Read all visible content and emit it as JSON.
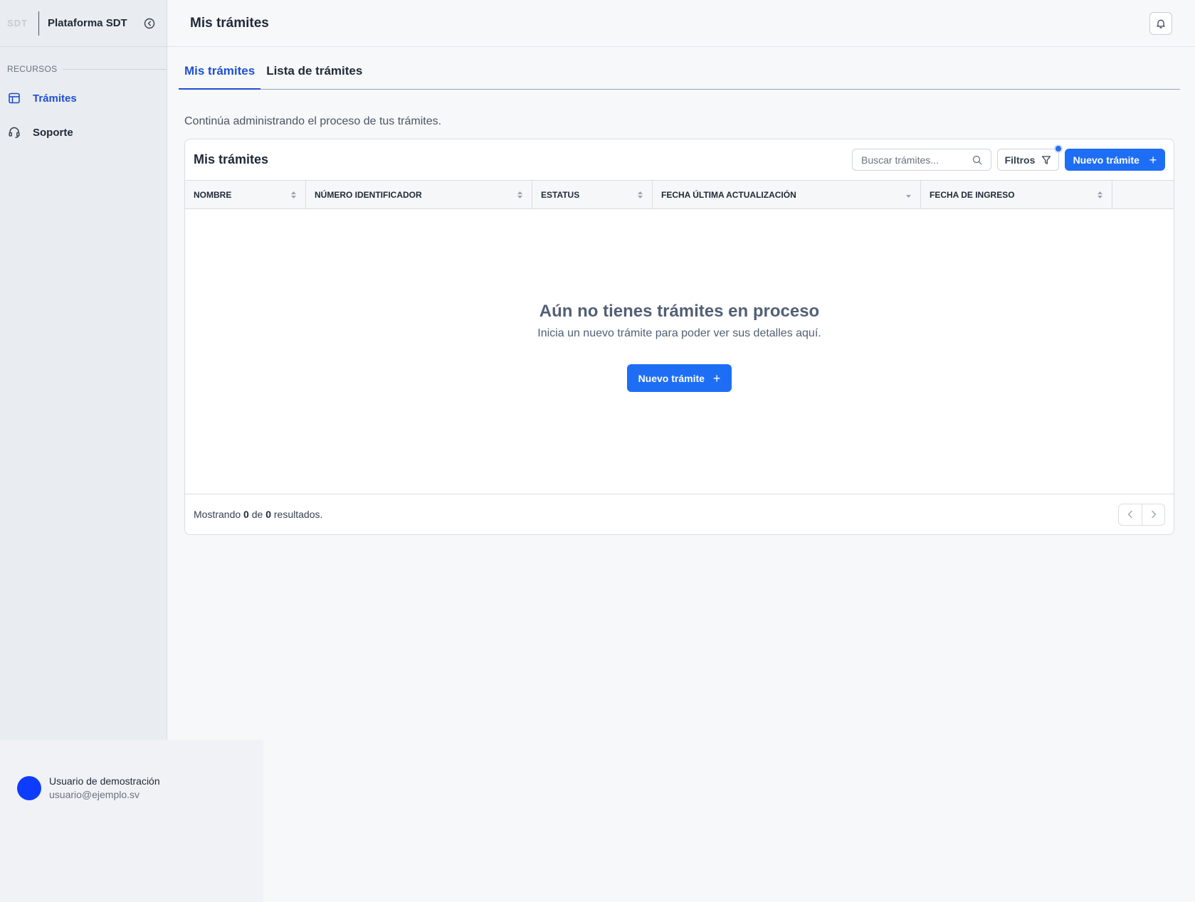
{
  "sidebar": {
    "logo": "SDT",
    "platform_name": "Plataforma SDT",
    "section_label": "RECURSOS",
    "items": [
      {
        "label": "Trámites",
        "icon": "layout-icon",
        "active": true
      },
      {
        "label": "Soporte",
        "icon": "headset-icon",
        "active": false
      }
    ]
  },
  "user": {
    "name": "Usuario de demostración",
    "email": "usuario@ejemplo.sv",
    "avatar_color": "#0d3cff"
  },
  "header": {
    "title": "Mis trámites"
  },
  "tabs": [
    {
      "label": "Mis trámites",
      "active": true
    },
    {
      "label": "Lista de trámites",
      "active": false
    }
  ],
  "subtitle": "Continúa administrando el proceso de tus trámites.",
  "card": {
    "title": "Mis trámites",
    "search_placeholder": "Buscar trámites...",
    "filters_label": "Filtros",
    "new_label": "Nuevo trámite",
    "columns": [
      "NOMBRE",
      "NÚMERO IDENTIFICADOR",
      "ESTATUS",
      "FECHA ÚLTIMA ACTUALIZACIÓN",
      "FECHA DE INGRESO"
    ],
    "empty": {
      "title": "Aún no tienes trámites en proceso",
      "subtitle": "Inicia un nuevo trámite para poder ver sus detalles aquí.",
      "button_label": "Nuevo trámite"
    },
    "footer": {
      "prefix": "Mostrando",
      "shown": "0",
      "of": "de",
      "total": "0",
      "suffix": "resultados."
    }
  },
  "colors": {
    "accent": "#1d6ef5",
    "active_nav": "#1f4fd1"
  }
}
